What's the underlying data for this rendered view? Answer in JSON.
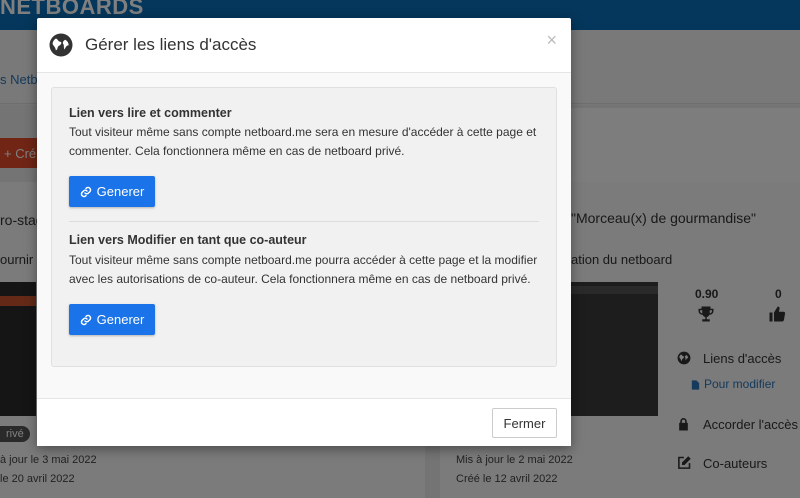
{
  "background": {
    "brand": "NETBOARDS",
    "breadcrumb": "s Netb",
    "create_button": "+ Cré",
    "left_card": {
      "title": "ro-stag",
      "subtitle": "ournir",
      "badge": "rivé",
      "updated": "à jour le 3 mai 2022",
      "created": "le 20 avril 2022"
    },
    "right_card": {
      "title": "\"Morceau(x) de gourmandise\"",
      "subtitle": "ation du netboard",
      "stat_score": "0.90",
      "stat_likes": "0",
      "link_access": "Liens d'accès",
      "link_modify": "Pour modifier",
      "grant_access": "Accorder l'accès",
      "coauthors": "Co-auteurs",
      "updated": "Mis à jour le 2 mai 2022",
      "created": "Créé le 12 avril 2022"
    }
  },
  "modal": {
    "title": "Gérer les liens d'accès",
    "close_glyph": "×",
    "section_read": {
      "title": "Lien vers lire et commenter",
      "text": "Tout visiteur même sans compte netboard.me sera en mesure d'accéder à cette page et commenter. Cela fonctionnera même en cas de netboard privé.",
      "button": "Generer"
    },
    "section_edit": {
      "title": "Lien vers Modifier en tant que co-auteur",
      "text": "Tout visiteur même sans compte netboard.me pourra accéder à cette page et la modifier avec les autorisations de co-auteur. Cela fonctionnera même en cas de netboard privé.",
      "button": "Generer"
    },
    "footer_button": "Fermer"
  },
  "icons": {
    "modal_title": "globe-icon",
    "generate": "link-icon",
    "close": "close-icon",
    "trophy": "trophy-icon",
    "thumbs_up": "thumbs-up-icon",
    "lock": "lock-icon",
    "edit": "edit-icon"
  },
  "colors": {
    "primary": "#1a73e8",
    "topbar": "#0b6fb8",
    "create": "#e04b2b"
  }
}
